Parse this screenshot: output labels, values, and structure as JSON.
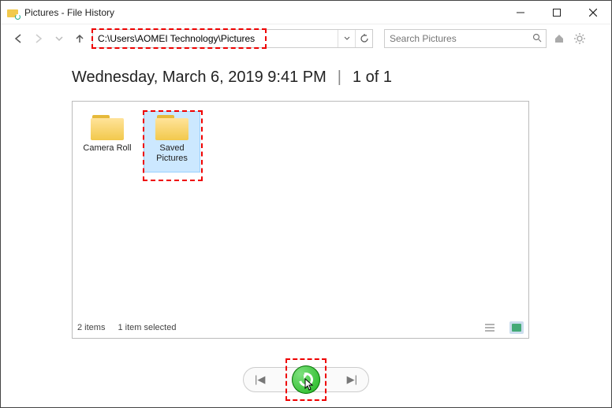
{
  "window": {
    "title": "Pictures - File History"
  },
  "nav": {
    "path": "C:\\Users\\AOMEI Technology\\Pictures",
    "search_placeholder": "Search Pictures"
  },
  "header": {
    "date": "Wednesday, March 6, 2019 9:41 PM",
    "separator": "|",
    "count": "1 of 1"
  },
  "folders": [
    {
      "name": "Camera Roll",
      "selected": false
    },
    {
      "name": "Saved Pictures",
      "selected": true
    }
  ],
  "status": {
    "items": "2 items",
    "selected": "1 item selected"
  },
  "controls": {
    "prev": "|◀",
    "next": "▶|"
  }
}
